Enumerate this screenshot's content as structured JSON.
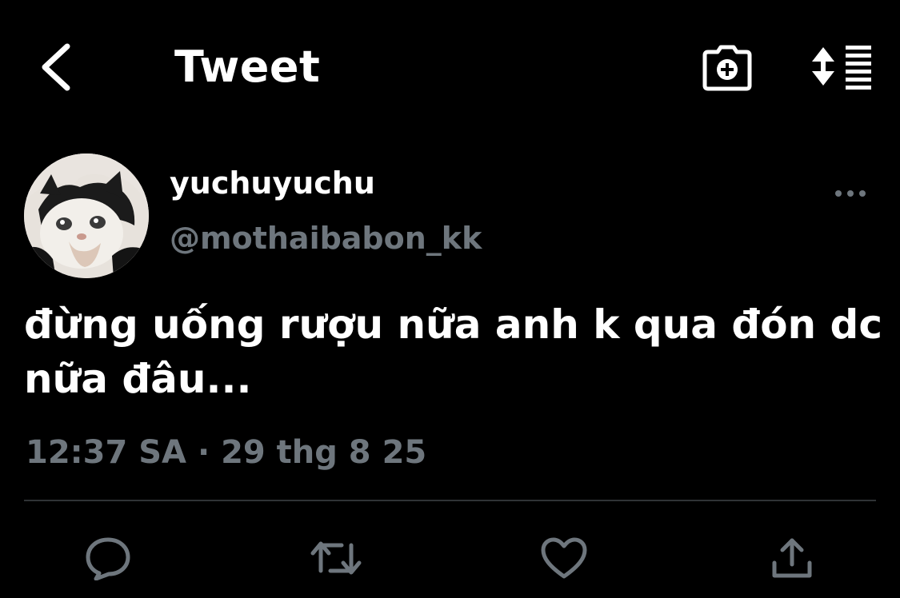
{
  "header": {
    "title": "Tweet",
    "back_icon": "chevron-left-icon",
    "camera_icon": "camera-plus-icon",
    "sort_icon": "sort-list-icon"
  },
  "tweet": {
    "author_name": "yuchuyuchu",
    "author_handle": "@mothaibabon_kk",
    "text": "đừng uống rượu nữa anh k qua đón dc\nnữa đâu...",
    "timestamp": "12:37 SA · 29 thg 8 25",
    "more_icon": "more-dots-icon"
  },
  "actions": {
    "reply_icon": "reply-icon",
    "retweet_icon": "retweet-icon",
    "like_icon": "heart-icon",
    "share_icon": "share-icon"
  },
  "colors": {
    "background": "#000000",
    "text": "#ffffff",
    "secondary": "#6e767d",
    "divider": "#2f3336"
  }
}
